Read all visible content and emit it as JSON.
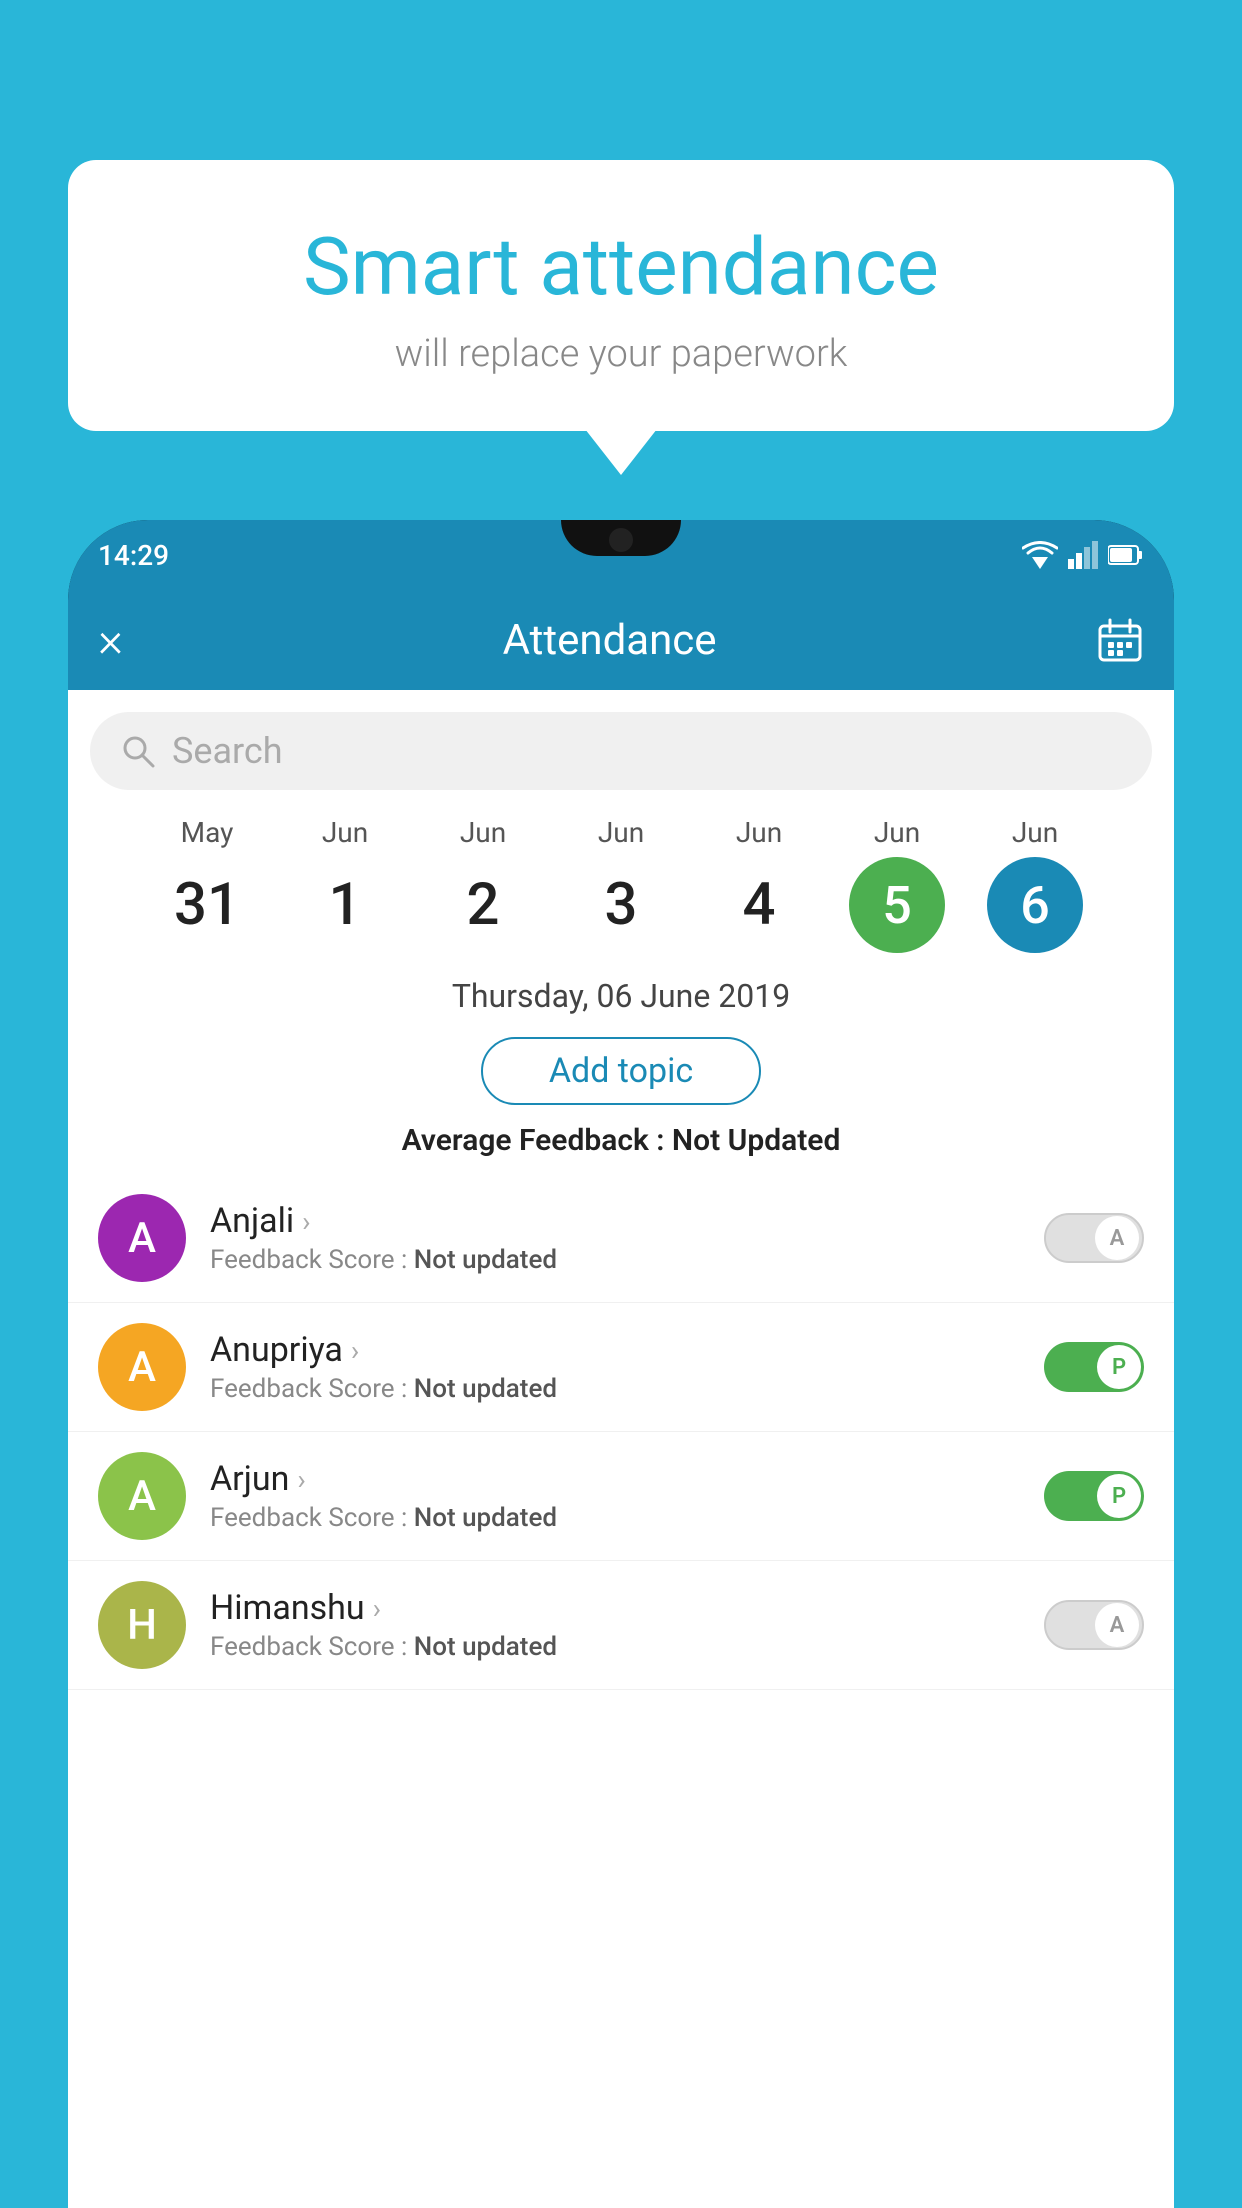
{
  "background_color": "#29b6d8",
  "speech_bubble": {
    "title": "Smart attendance",
    "subtitle": "will replace your paperwork"
  },
  "status_bar": {
    "time": "14:29"
  },
  "toolbar": {
    "title": "Attendance",
    "close_label": "×",
    "calendar_icon": "calendar-icon"
  },
  "search": {
    "placeholder": "Search"
  },
  "dates": [
    {
      "month": "May",
      "day": "31",
      "style": "normal"
    },
    {
      "month": "Jun",
      "day": "1",
      "style": "normal"
    },
    {
      "month": "Jun",
      "day": "2",
      "style": "normal"
    },
    {
      "month": "Jun",
      "day": "3",
      "style": "normal"
    },
    {
      "month": "Jun",
      "day": "4",
      "style": "normal"
    },
    {
      "month": "Jun",
      "day": "5",
      "style": "active-green"
    },
    {
      "month": "Jun",
      "day": "6",
      "style": "active-blue"
    }
  ],
  "selected_date": "Thursday, 06 June 2019",
  "add_topic_label": "Add topic",
  "average_feedback": {
    "label": "Average Feedback : ",
    "value": "Not Updated"
  },
  "students": [
    {
      "name": "Anjali",
      "avatar_letter": "A",
      "avatar_color": "#9c27b0",
      "feedback_label": "Feedback Score : ",
      "feedback_value": "Not updated",
      "toggle": "off",
      "toggle_letter": "A"
    },
    {
      "name": "Anupriya",
      "avatar_letter": "A",
      "avatar_color": "#f5a623",
      "feedback_label": "Feedback Score : ",
      "feedback_value": "Not updated",
      "toggle": "on",
      "toggle_letter": "P"
    },
    {
      "name": "Arjun",
      "avatar_letter": "A",
      "avatar_color": "#8bc34a",
      "feedback_label": "Feedback Score : ",
      "feedback_value": "Not updated",
      "toggle": "on",
      "toggle_letter": "P"
    },
    {
      "name": "Himanshu",
      "avatar_letter": "H",
      "avatar_color": "#aab54a",
      "feedback_label": "Feedback Score : ",
      "feedback_value": "Not updated",
      "toggle": "off",
      "toggle_letter": "A"
    }
  ]
}
